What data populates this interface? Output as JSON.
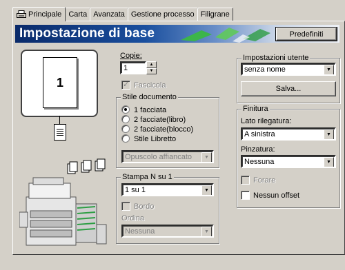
{
  "tabs": [
    {
      "label": "Principale",
      "active": true
    },
    {
      "label": "Carta"
    },
    {
      "label": "Avanzata"
    },
    {
      "label": "Gestione processo"
    },
    {
      "label": "Filigrane"
    }
  ],
  "banner": {
    "title": "Impostazione di base",
    "defaults_button": "Predefiniti"
  },
  "preview": {
    "page_number": "1"
  },
  "copies": {
    "label": "Copie:",
    "value": "1"
  },
  "collate": {
    "label": "Fascicola",
    "checked": true,
    "enabled": false
  },
  "document_style": {
    "group_label": "Stile documento",
    "options": [
      {
        "label": "1 facciata",
        "checked": true
      },
      {
        "label": "2 facciate(libro)",
        "checked": false
      },
      {
        "label": "2 facciate(blocco)",
        "checked": false
      },
      {
        "label": "Stile Libretto",
        "checked": false
      }
    ],
    "booklet_select": "Opuscolo affiancato"
  },
  "n_up": {
    "group_label": "Stampa N su 1",
    "select": "1 su 1",
    "border_label": "Bordo",
    "order_label": "Ordina",
    "order_select": "Nessuna"
  },
  "user_settings": {
    "group_label": "Impostazioni utente",
    "select": "senza nome",
    "save_button": "Salva..."
  },
  "finishing": {
    "group_label": "Finitura",
    "binding_label": "Lato rilegatura:",
    "binding_select": "A sinistra",
    "staple_label": "Pinzatura:",
    "staple_select": "Nessuna",
    "punch_label": "Forare",
    "no_offset_label": "Nessun offset"
  }
}
